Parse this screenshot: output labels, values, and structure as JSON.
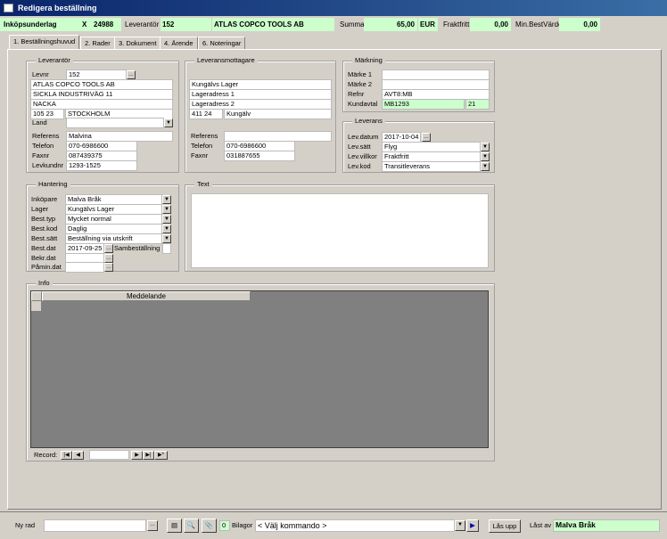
{
  "window": {
    "title": "Redigera beställning"
  },
  "header": {
    "inkop_label": "Inköpsunderlag",
    "x_label": "X",
    "order_no": "24988",
    "leverantor_label": "Leverantör",
    "leverantor_no": "152",
    "leverantor_name": "ATLAS COPCO TOOLS AB",
    "summa_label": "Summa",
    "summa_value": "65,00",
    "currency": "EUR",
    "fraktfritt_label": "Fraktfritt",
    "fraktfritt_value": "0,00",
    "minbest_label": "Min.BestVärde",
    "minbest_value": "0,00"
  },
  "tabs": [
    {
      "label": "1. Beställningshuvud"
    },
    {
      "label": "2. Rader"
    },
    {
      "label": "3. Dokument"
    },
    {
      "label": "4. Ärende"
    },
    {
      "label": "6. Noteringar"
    }
  ],
  "leverantor": {
    "title": "Leverantör",
    "levnr_label": "Levnr",
    "levnr": "152",
    "name": "ATLAS COPCO TOOLS AB",
    "address": "SICKLA INDUSTRIVÄG 11",
    "city1": "NACKA",
    "postnr": "105 23",
    "city2": "STOCKHOLM",
    "land_label": "Land",
    "referens_label": "Referens",
    "referens": "Malvina",
    "telefon_label": "Telefon",
    "telefon": "070-6986600",
    "faxnr_label": "Faxnr",
    "faxnr": "087439375",
    "levkundnr_label": "Levkundnr",
    "levkundnr": "1293-1525"
  },
  "mottagare": {
    "title": "Leveransmottagare",
    "name": "Kungälvs Lager",
    "adress1": "Lageradress 1",
    "adress2": "Lageradress 2",
    "postnr": "411 24",
    "city": "Kungälv",
    "referens_label": "Referens",
    "telefon_label": "Telefon",
    "telefon": "070-6986600",
    "faxnr_label": "Faxnr",
    "faxnr": "031887655"
  },
  "markning": {
    "title": "Märkning",
    "marke1_label": "Märke 1",
    "marke2_label": "Märke 2",
    "refnr_label": "Refnr",
    "refnr": "AVT8:MB",
    "kundavtal_label": "Kundavtal",
    "kundavtal": "MB1293",
    "kundavtal_no": "21"
  },
  "leverans": {
    "title": "Leverans",
    "levdatum_label": "Lev.datum",
    "levdatum": "2017-10-04",
    "levsatt_label": "Lev.sätt",
    "levsatt": "Flyg",
    "levvillkor_label": "Lev.villkor",
    "levvillkor": "Fraktfritt",
    "levkod_label": "Lev.kod",
    "levkod": "Transitleverans"
  },
  "hantering": {
    "title": "Hantering",
    "inkopare_label": "Inköpare",
    "inkopare": "Malva Bråk",
    "lager_label": "Lager",
    "lager": "Kungälvs Lager",
    "besttyp_label": "Best.typ",
    "besttyp": "Mycket normal",
    "bestkod_label": "Best.kod",
    "bestkod": "Daglig",
    "bestsatt_label": "Best.sätt",
    "bestsatt": "Beställning via utskrift",
    "bestdat_label": "Best.dat",
    "bestdat": "2017-09-25",
    "sambest_label": "Sambeställning",
    "bekrdat_label": "Bekr.dat",
    "pamindat_label": "Påmin.dat"
  },
  "text": {
    "title": "Text"
  },
  "info": {
    "title": "Info",
    "col_meddelande": "Meddelande",
    "record_label": "Record:"
  },
  "footer": {
    "nyrad_label": "Ny rad",
    "bilagor_count": "0",
    "bilagor_label": "Bilagor",
    "command_placeholder": "< Välj kommando >",
    "las_upp_label": "Lås upp",
    "last_av_label": "Låst av",
    "last_av": "Malva Bråk"
  }
}
